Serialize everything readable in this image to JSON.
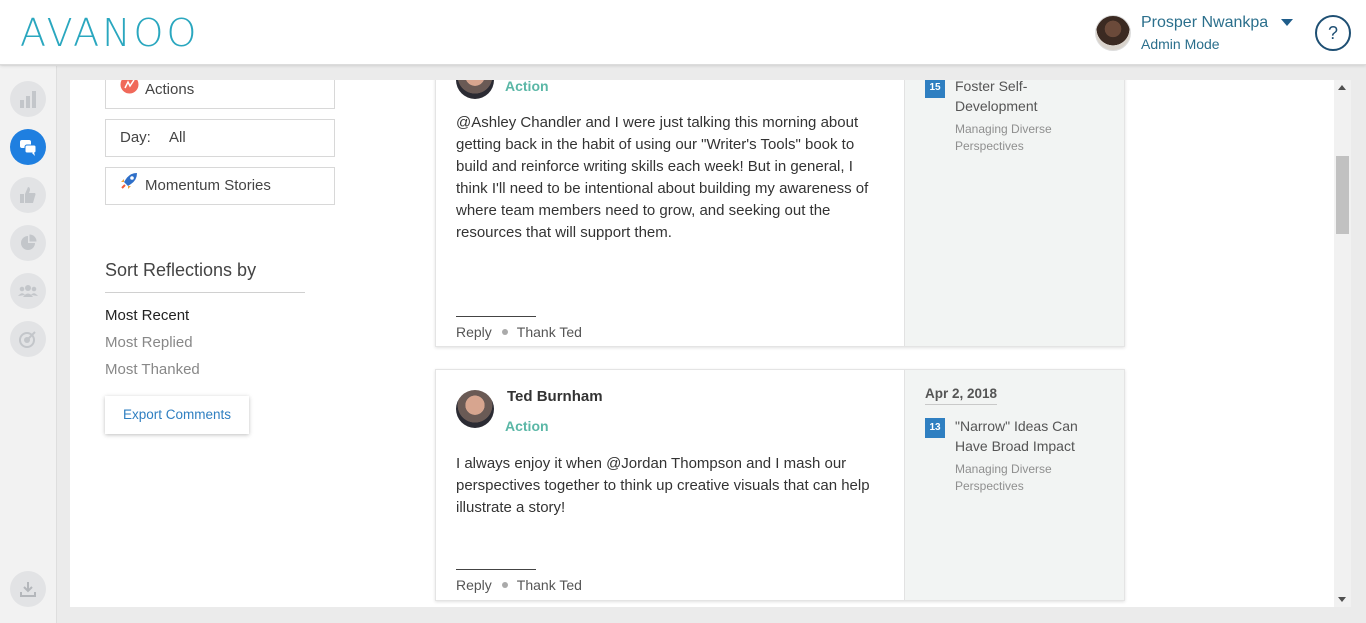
{
  "app": {
    "logo": "AVANOO"
  },
  "user": {
    "name": "Prosper Nwankpa",
    "mode": "Admin Mode"
  },
  "help": {
    "label": "?"
  },
  "filters": {
    "actions_label": "Actions",
    "day_label": "Day:",
    "day_value": "All",
    "momentum_label": "Momentum Stories"
  },
  "sort": {
    "title": "Sort Reflections by",
    "options": [
      "Most Recent",
      "Most Replied",
      "Most Thanked"
    ],
    "selected": "Most Recent"
  },
  "export_label": "Export Comments",
  "reflections": [
    {
      "author": "",
      "type": "Action",
      "text": "@Ashley Chandler and I were just talking this morning about getting back in the habit of using our \"Writer's Tools\" book to build and reinforce writing skills each week! But in general, I think I'll need to be intentional about building my awareness of where team members need to grow, and seeking out the resources that will support them.",
      "reply": "Reply",
      "thank": "Thank Ted",
      "date": "",
      "day_num": "15",
      "topic_title": "Foster Self-Development",
      "topic": "Managing Diverse Perspectives"
    },
    {
      "author": "Ted Burnham",
      "type": "Action",
      "text": "I always enjoy it when @Jordan Thompson and I mash our perspectives together to think up creative visuals that can help illustrate a story!",
      "reply": "Reply",
      "thank": "Thank Ted",
      "date": "Apr 2, 2018",
      "day_num": "13",
      "topic_title": "\"Narrow\" Ideas Can Have Broad Impact",
      "topic": "Managing Diverse Perspectives"
    }
  ],
  "colors": {
    "brand": "#2aa7bf",
    "accent": "#1f7fe0",
    "action_label": "#5ab7a6",
    "link": "#2f7fc1"
  },
  "rail_icons": [
    "bar-chart-icon",
    "chat-icon",
    "thumbs-up-icon",
    "pie-chart-icon",
    "team-icon",
    "target-icon",
    "download-icon"
  ]
}
